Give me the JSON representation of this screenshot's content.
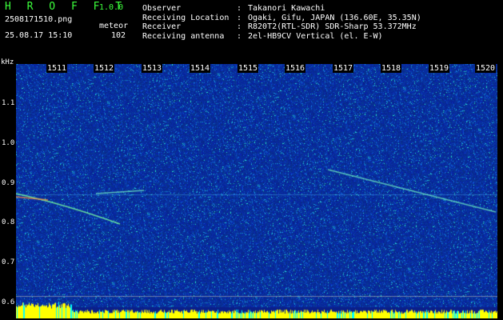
{
  "app": {
    "title": "H R O F F T",
    "version": "1.0.0"
  },
  "file": {
    "name": "2508171510.png",
    "datetime": "25.08.17 15:10"
  },
  "detection": {
    "label": "meteor",
    "count": "102"
  },
  "info": [
    {
      "key": "Observer",
      "value": "Takanori Kawachi"
    },
    {
      "key": "Receiving Location",
      "value": "Ogaki, Gifu, JAPAN (136.60E, 35.35N)"
    },
    {
      "key": "Receiver",
      "value": "R820T2(RTL-SDR) SDR-Sharp 53.372MHz"
    },
    {
      "key": "Receiving antenna",
      "value": "2el-HB9CV Vertical (el. E-W)"
    }
  ],
  "axis": {
    "y_unit": "kHz",
    "y_ticks": [
      "1.1",
      "1.0",
      "0.9",
      "0.8",
      "0.7",
      "0.6"
    ],
    "x_ticks": [
      "1511",
      "1512",
      "1513",
      "1514",
      "1515",
      "1516",
      "1517",
      "1518",
      "1519",
      "1520"
    ]
  },
  "colors": {
    "background": "#0a1f8a",
    "accent": "#3cff3c",
    "level_bar": "#ffff00",
    "level_cyan": "#00ffff"
  }
}
